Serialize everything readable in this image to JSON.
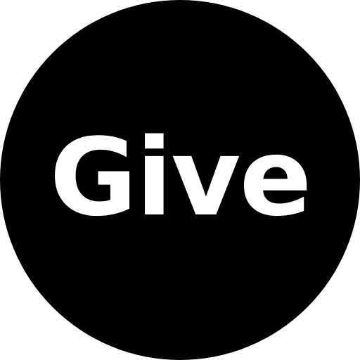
{
  "badge": {
    "label": "Give",
    "background_color": "#000000",
    "text_color": "#ffffff"
  }
}
